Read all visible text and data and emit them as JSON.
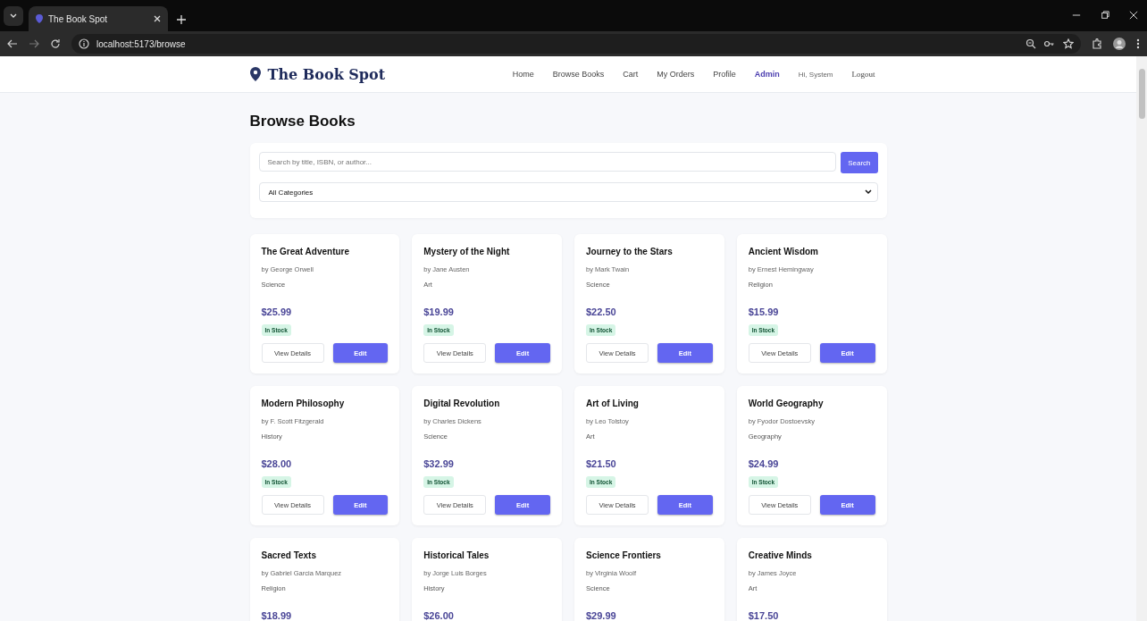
{
  "browser": {
    "tab_title": "The Book Spot",
    "url": "localhost:5173/browse"
  },
  "header": {
    "brand": "The Book Spot",
    "nav": [
      {
        "label": "Home",
        "selected": false
      },
      {
        "label": "Browse Books",
        "selected": false
      },
      {
        "label": "Cart",
        "selected": false
      },
      {
        "label": "My Orders",
        "selected": false
      },
      {
        "label": "Profile",
        "selected": false
      },
      {
        "label": "Admin",
        "selected": true
      }
    ],
    "greeting": "Hi, System",
    "logout": "Logout"
  },
  "page_title": "Browse Books",
  "search": {
    "placeholder": "Search by title, ISBN, or author...",
    "button": "Search",
    "category": "All Categories"
  },
  "books": [
    {
      "title": "The Great Adventure",
      "author": "by George Orwell",
      "category": "Science",
      "price": "$25.99",
      "stock": "In Stock",
      "buttons": [
        "View Details",
        "Edit"
      ]
    },
    {
      "title": "Mystery of the Night",
      "author": "by Jane Austen",
      "category": "Art",
      "price": "$19.99",
      "stock": "In Stock",
      "buttons": [
        "View Details",
        "Edit"
      ]
    },
    {
      "title": "Journey to the Stars",
      "author": "by Mark Twain",
      "category": "Science",
      "price": "$22.50",
      "stock": "In Stock",
      "buttons": [
        "View Details",
        "Edit"
      ]
    },
    {
      "title": "Ancient Wisdom",
      "author": "by Ernest Hemingway",
      "category": "Religion",
      "price": "$15.99",
      "stock": "In Stock",
      "buttons": [
        "View Details",
        "Edit"
      ]
    },
    {
      "title": "Modern Philosophy",
      "author": "by F. Scott Fitzgerald",
      "category": "History",
      "price": "$28.00",
      "stock": "In Stock",
      "buttons": [
        "View Details",
        "Edit"
      ]
    },
    {
      "title": "Digital Revolution",
      "author": "by Charles Dickens",
      "category": "Science",
      "price": "$32.99",
      "stock": "In Stock",
      "buttons": [
        "View Details",
        "Edit"
      ]
    },
    {
      "title": "Art of Living",
      "author": "by Leo Tolstoy",
      "category": "Art",
      "price": "$21.50",
      "stock": "In Stock",
      "buttons": [
        "View Details",
        "Edit"
      ]
    },
    {
      "title": "World Geography",
      "author": "by Fyodor Dostoevsky",
      "category": "Geography",
      "price": "$24.99",
      "stock": "In Stock",
      "buttons": [
        "View Details",
        "Edit"
      ]
    },
    {
      "title": "Sacred Texts",
      "author": "by Gabriel Garcia Marquez",
      "category": "Religion",
      "price": "$18.99"
    },
    {
      "title": "Historical Tales",
      "author": "by Jorge Luis Borges",
      "category": "History",
      "price": "$26.00"
    },
    {
      "title": "Science Frontiers",
      "author": "by Virginia Woolf",
      "category": "Science",
      "price": "$29.99"
    },
    {
      "title": "Creative Minds",
      "author": "by James Joyce",
      "category": "Art",
      "price": "$17.50"
    }
  ]
}
